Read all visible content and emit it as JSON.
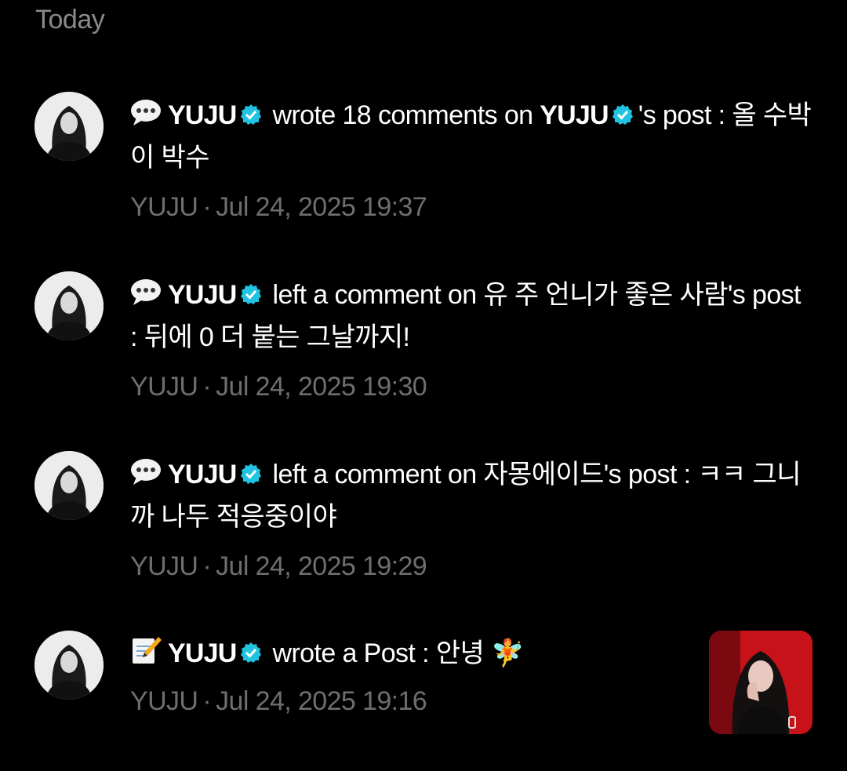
{
  "section": {
    "title": "Today"
  },
  "colors": {
    "background": "#000000",
    "verified": "#20c4e0",
    "meta": "#6e6e6e"
  },
  "notifications": [
    {
      "icon": "speech-bubble-icon",
      "actor": "YUJU",
      "action": "wrote 18 comments on",
      "target": "YUJU",
      "suffix": "'s post : 올 수박이 박수",
      "author": "YUJU",
      "separator": "·",
      "time": "Jul 24, 2025 19:37"
    },
    {
      "icon": "speech-bubble-icon",
      "actor": "YUJU",
      "action": "left a comment on 유 주 언니가 좋은 사람's post : 뒤에 0 더 붙는 그날까지!",
      "author": "YUJU",
      "separator": "·",
      "time": "Jul 24, 2025 19:30"
    },
    {
      "icon": "speech-bubble-icon",
      "actor": "YUJU",
      "action": "left a comment on 자몽에이드's post : ㅋㅋ 그니까 나두 적응중이야",
      "author": "YUJU",
      "separator": "·",
      "time": "Jul 24, 2025 19:29"
    },
    {
      "icon": "memo-icon",
      "actor": "YUJU",
      "action": "wrote a Post : 안녕 🧚",
      "author": "YUJU",
      "separator": "·",
      "time": "Jul 24, 2025 19:16",
      "thumbnail": "post-thumbnail"
    }
  ]
}
